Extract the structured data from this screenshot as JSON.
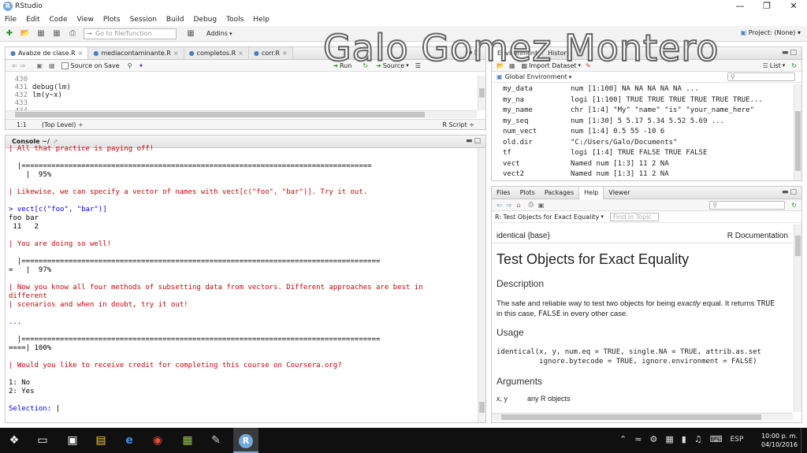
{
  "window": {
    "title": "RStudio"
  },
  "menu": [
    "File",
    "Edit",
    "Code",
    "View",
    "Plots",
    "Session",
    "Build",
    "Debug",
    "Tools",
    "Help"
  ],
  "toolbar": {
    "goto_placeholder": "Go to file/function",
    "addins": "Addins",
    "project": "Project: (None)"
  },
  "watermark": "Galo Gomez Montero",
  "editor": {
    "tabs": [
      "Avabze de clase.R",
      "mediacontaminante.R",
      "completos.R",
      "corr.R"
    ],
    "source_on_save": "Source on Save",
    "run": "Run",
    "source": "Source",
    "lines": [
      {
        "n": "430",
        "text": ""
      },
      {
        "n": "431",
        "text": "debug(lm)"
      },
      {
        "n": "432",
        "text": "lm(y~x)"
      },
      {
        "n": "433",
        "text": ""
      },
      {
        "n": "434",
        "text": ""
      }
    ],
    "status_pos": "1:1",
    "status_scope": "(Top Level) ÷",
    "status_type": "R Script ÷"
  },
  "console": {
    "title": "Console ~/",
    "lines": [
      {
        "t": "| All that practice is paying off!",
        "c": "red"
      },
      {
        "t": "",
        "c": "navy"
      },
      {
        "t": "  |==================================================================================",
        "c": "navy"
      },
      {
        "t": "    |  95%",
        "c": "navy"
      },
      {
        "t": "",
        "c": "navy"
      },
      {
        "t": "| Likewise, we can specify a vector of names with vect[c(\"foo\", \"bar\")]. Try it out.",
        "c": "red"
      },
      {
        "t": "",
        "c": "navy"
      },
      {
        "t": "> vect[c(\"foo\", \"bar\")]",
        "c": "blue"
      },
      {
        "t": "foo bar",
        "c": "navy"
      },
      {
        "t": " 11   2",
        "c": "navy"
      },
      {
        "t": "",
        "c": "navy"
      },
      {
        "t": "| You are doing so well!",
        "c": "red"
      },
      {
        "t": "",
        "c": "navy"
      },
      {
        "t": "  |====================================================================================",
        "c": "navy"
      },
      {
        "t": "=   |  97%",
        "c": "navy"
      },
      {
        "t": "",
        "c": "navy"
      },
      {
        "t": "| Now you know all four methods of subsetting data from vectors. Different approaches are best in",
        "c": "red"
      },
      {
        "t": "different",
        "c": "red"
      },
      {
        "t": "| scenarios and when in doubt, try it out!",
        "c": "red"
      },
      {
        "t": "",
        "c": "navy"
      },
      {
        "t": "...",
        "c": "blue"
      },
      {
        "t": "",
        "c": "navy"
      },
      {
        "t": "  |====================================================================================",
        "c": "navy"
      },
      {
        "t": "====| 100%",
        "c": "navy"
      },
      {
        "t": "",
        "c": "navy"
      },
      {
        "t": "| Would you like to receive credit for completing this course on Coursera.org?",
        "c": "red"
      },
      {
        "t": "",
        "c": "navy"
      },
      {
        "t": "1: No",
        "c": "navy"
      },
      {
        "t": "2: Yes",
        "c": "navy"
      },
      {
        "t": "",
        "c": "navy"
      },
      {
        "t": "Selection: ",
        "c": "blue"
      }
    ]
  },
  "env": {
    "tabs": [
      "Environment",
      "History"
    ],
    "import": "Import Dataset",
    "list": "List",
    "scope": "Global Environment",
    "rows": [
      {
        "n": "my_data",
        "v": "num [1:100] NA NA NA NA NA ..."
      },
      {
        "n": "my_na",
        "v": "logi [1:100] TRUE TRUE TRUE TRUE TRUE TRUE..."
      },
      {
        "n": "my_name",
        "v": "chr [1:4] \"My\" \"name\" \"is\" \"your_name_here\""
      },
      {
        "n": "my_seq",
        "v": "num [1:30] 5 5.17 5.34 5.52 5.69 ..."
      },
      {
        "n": "num_vect",
        "v": "num [1:4] 0.5 55 -10 6"
      },
      {
        "n": "old.dir",
        "v": "\"C:/Users/Galo/Documents\""
      },
      {
        "n": "tf",
        "v": "logi [1:4] TRUE FALSE TRUE FALSE"
      },
      {
        "n": "vect",
        "v": "Named num [1:3] 11 2 NA"
      },
      {
        "n": "vect2",
        "v": "Named num [1:3] 11 2 NA"
      }
    ]
  },
  "help": {
    "tabs": [
      "Files",
      "Plots",
      "Packages",
      "Help",
      "Viewer"
    ],
    "topic_bar": "R: Test Objects for Exact Equality",
    "find_placeholder": "Find in Topic",
    "pkg": "identical {base}",
    "rdoc": "R Documentation",
    "title": "Test Objects for Exact Equality",
    "h_desc": "Description",
    "desc_a": "The safe and reliable way to test two objects for being ",
    "desc_em": "exactly",
    "desc_b": " equal. It returns ",
    "desc_true": "TRUE",
    "desc_c": "in this case, ",
    "desc_false": "FALSE",
    "desc_d": " in every other case.",
    "h_usage": "Usage",
    "usage1": "identical(x, y, num.eq = TRUE, single.NA = TRUE, attrib.as.set",
    "usage2": "          ignore.bytecode = TRUE, ignore.environment = FALSE)",
    "h_args": "Arguments",
    "args_cut": "x, y          any R objects"
  },
  "taskbar": {
    "lang": "ESP",
    "time": "10:00 p. m.",
    "date": "04/10/2016"
  }
}
